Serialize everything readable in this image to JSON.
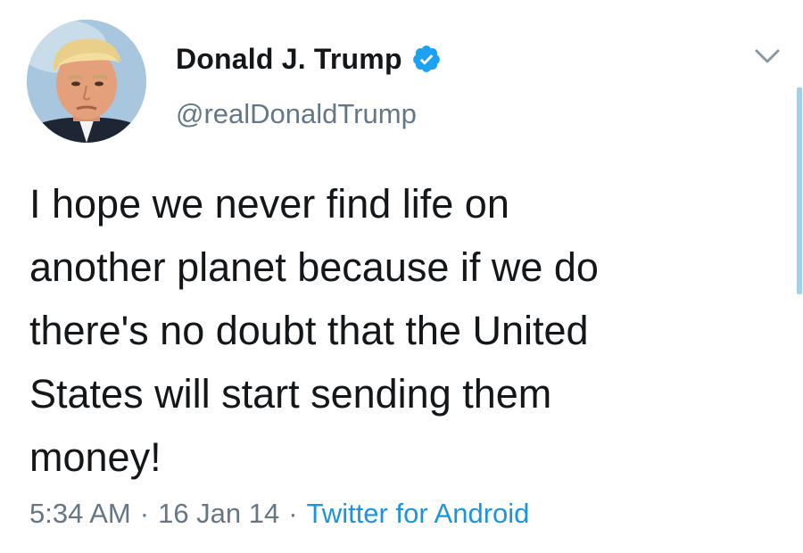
{
  "tweet": {
    "display_name": "Donald J. Trump",
    "handle": "@realDonaldTrump",
    "verified": true,
    "text_lines": [
      "I hope we never find life on",
      "another planet because if we do",
      "there's no doubt that the United",
      "States will start sending them",
      "money!"
    ],
    "time": "5:34 AM",
    "separator": "·",
    "date": "16 Jan 14",
    "source": "Twitter for Android"
  },
  "icons": {
    "verified": "verified-badge-icon",
    "menu": "chevron-down-icon",
    "avatar": "profile-avatar"
  },
  "colors": {
    "text": "#14171a",
    "muted": "#657786",
    "link": "#1b95e0",
    "verified": "#1da1f2",
    "scroll_indicator": "#9fd0f0"
  }
}
